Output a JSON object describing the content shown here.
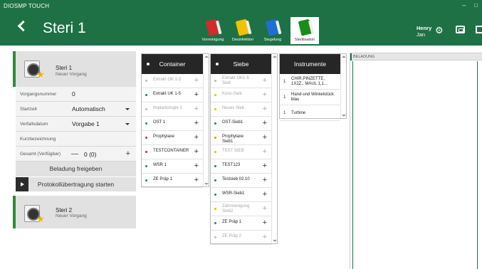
{
  "app": {
    "title": "DIOSMP TOUCH"
  },
  "header": {
    "title": "Steri 1",
    "user_name": "Henry",
    "user_sub": "Jan",
    "tabs": [
      {
        "label": "Vorreinigung",
        "color": "#d42a2a",
        "active": false
      },
      {
        "label": "Desinfektion",
        "color": "#f2c200",
        "active": false
      },
      {
        "label": "Siegelung",
        "color": "#1e6fd0",
        "active": false
      },
      {
        "label": "Sterilisation",
        "color": "#1a8c1a",
        "active": true
      }
    ]
  },
  "cards": [
    {
      "title": "Steri 1",
      "subtitle": "Neuer Vorgang"
    },
    {
      "title": "Steri 2",
      "subtitle": "Neuer Vorgang"
    }
  ],
  "form": {
    "vorgangsnummer": {
      "label": "Vorgangsnummer",
      "value": "0"
    },
    "startzeit": {
      "label": "Startzeit",
      "value": "Automatisch"
    },
    "verfallsdatum": {
      "label": "Verfallsdatum",
      "value": "Vorgabe 1"
    },
    "kurzbezeichnung": {
      "label": "Kurzbezeichnung",
      "value": ""
    },
    "gesamt": {
      "label": "Gesamt (Verfügbar)",
      "value": "0 (0)"
    }
  },
  "buttons": {
    "freigeben": "Beladung freigeben",
    "protokoll": "Protokollübertragung starten"
  },
  "container": {
    "header": "Container",
    "items": [
      {
        "label": "Extrakt OK 1-5",
        "color": "#bbbbbb",
        "dim": true
      },
      {
        "label": "Extrakt UK 1-5",
        "color": "#1e8c3a",
        "dim": false
      },
      {
        "label": "Implantologie 1",
        "color": "#bbbbbb",
        "dim": true
      },
      {
        "label": "OST 1",
        "color": "#1e8c3a",
        "dim": false
      },
      {
        "label": "Prophylaxe",
        "color": "#cc2a2a",
        "dim": false
      },
      {
        "label": "TESTCONTAINER",
        "color": "#cc2a2a",
        "dim": false
      },
      {
        "label": "WSR 1",
        "color": "#1e8c3a",
        "dim": false
      },
      {
        "label": "ZE Präp 1",
        "color": "#1e8c3a",
        "dim": false
      }
    ]
  },
  "siebe": {
    "header": "Siebe",
    "items": [
      {
        "label": "Extrakt OK1-5 Sieb",
        "color": "#bbbbbb",
        "dim": true
      },
      {
        "label": "Kons-Sieb",
        "color": "#e6c200",
        "dim": true
      },
      {
        "label": "Neues Sieb",
        "color": "#e6c200",
        "dim": true
      },
      {
        "label": "OST-Sieb1",
        "color": "#1e8c3a",
        "dim": false
      },
      {
        "label": "Prophylaxe Sieb1",
        "color": "#e69a00",
        "dim": false
      },
      {
        "label": "TEST SIEB",
        "color": "#e6c200",
        "dim": true
      },
      {
        "label": "TEST123",
        "color": "#1e8c3a",
        "dim": false
      },
      {
        "label": "Testsieb 02.10",
        "color": "#1e8c3a",
        "dim": false
      },
      {
        "label": "WSR-Sieb1",
        "color": "#1e8c3a",
        "dim": false
      },
      {
        "label": "Zahnreinigung Sieb2",
        "color": "#e6c200",
        "dim": true
      },
      {
        "label": "ZE Präp 1",
        "color": "#1e8c3a",
        "dim": false
      },
      {
        "label": "ZE Präp 2",
        "color": "#bbbbbb",
        "dim": true
      }
    ]
  },
  "instrumente": {
    "header": "Instrumente",
    "items": [
      {
        "qty": "1",
        "label": "CHIR.PINZETTE, 1X2Z., MAUL 1,1..."
      },
      {
        "qty": "1",
        "label": "Hand-und Winkelstück blau"
      },
      {
        "qty": "1",
        "label": "Turbine"
      }
    ]
  },
  "beladung": {
    "header": "BELADUNG"
  }
}
